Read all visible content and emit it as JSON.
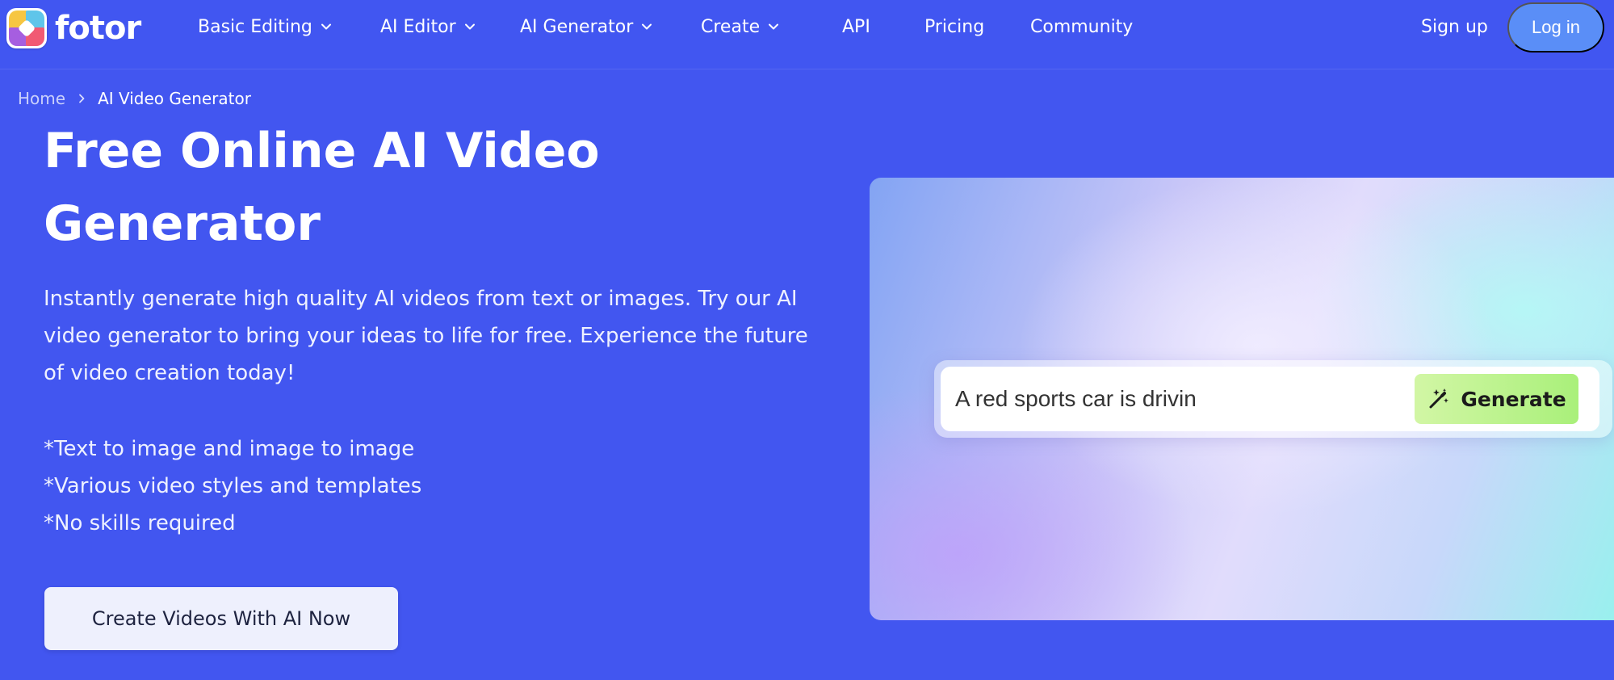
{
  "brand": {
    "name": "fotor"
  },
  "nav": {
    "items": [
      {
        "label": "Basic Editing",
        "has_dropdown": true
      },
      {
        "label": "AI Editor",
        "has_dropdown": true
      },
      {
        "label": "AI Generator",
        "has_dropdown": true
      },
      {
        "label": "Create",
        "has_dropdown": true
      },
      {
        "label": "API",
        "has_dropdown": false
      },
      {
        "label": "Pricing",
        "has_dropdown": false
      },
      {
        "label": "Community",
        "has_dropdown": false
      }
    ],
    "signup_label": "Sign up",
    "login_label": "Log in"
  },
  "breadcrumb": {
    "home": "Home",
    "current": "AI Video Generator"
  },
  "hero": {
    "title_line1": "Free Online AI Video",
    "title_line2": "Generator",
    "description": "Instantly generate high quality AI videos from text or images. Try our AI video generator to bring your ideas to life for free. Experience the future of video creation today!",
    "features": [
      "*Text to image and image to image",
      "*Various video styles and templates",
      "*No skills required"
    ],
    "cta_label": "Create Videos With AI Now"
  },
  "preview": {
    "prompt_value": "A red sports car is drivin",
    "generate_label": "Generate"
  },
  "colors": {
    "background": "#4256f0",
    "login_button": "#5a8ef7",
    "generate_button": "#a9f07a",
    "cta_button": "#eef0fd"
  }
}
